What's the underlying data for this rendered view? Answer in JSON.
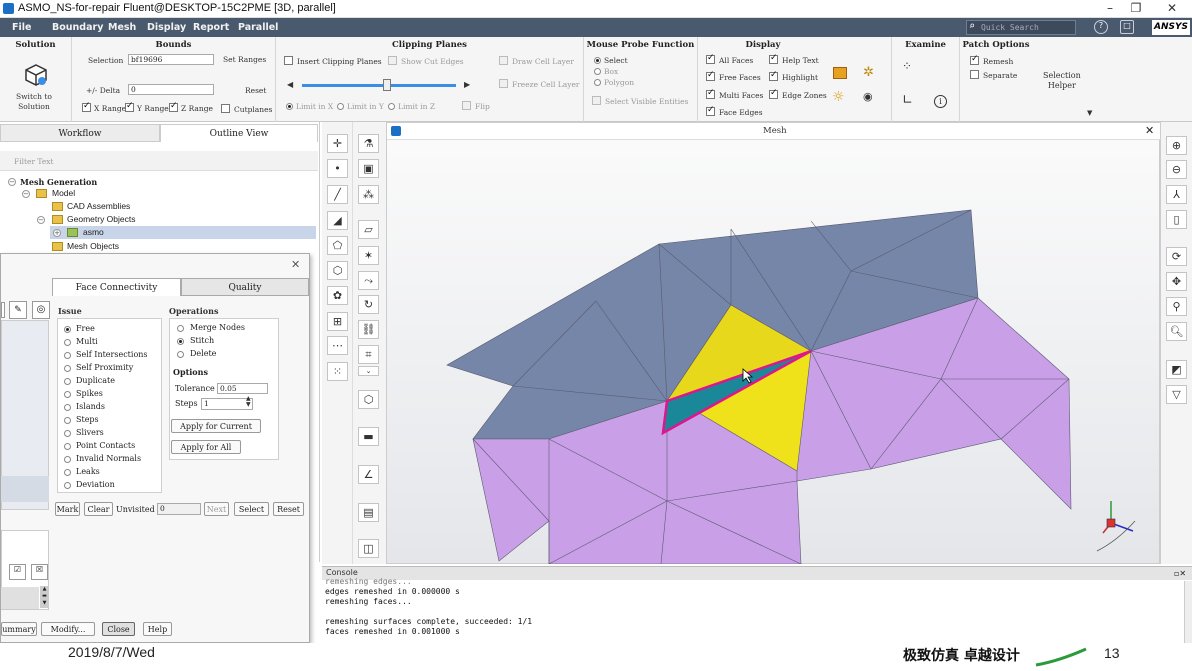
{
  "window": {
    "title": "ASMO_NS-for-repair Fluent@DESKTOP-15C2PME  [3D, parallel]"
  },
  "menu": {
    "items": [
      "File",
      "Boundary",
      "Mesh",
      "Display",
      "Report",
      "Parallel"
    ],
    "search_placeholder": "Quick Search",
    "brand": "ANSYS"
  },
  "ribbon": {
    "solution": {
      "title": "Solution",
      "switch_label": "Switch to\nSolution"
    },
    "bounds": {
      "title": "Bounds",
      "selection_label": "Selection",
      "selection_value": "bf19696",
      "set_ranges": "Set Ranges",
      "delta_label": "+/- Delta",
      "delta_value": "0",
      "reset": "Reset",
      "x_range": "X Range",
      "y_range": "Y Range",
      "z_range": "Z Range",
      "cutplanes": "Cutplanes"
    },
    "clipping": {
      "title": "Clipping Planes",
      "insert": "Insert Clipping Planes",
      "show_cut_edges": "Show Cut Edges",
      "draw_cell_layer": "Draw Cell Layer",
      "freeze_cell_layer": "Freeze Cell Layer",
      "limit_x": "Limit in X",
      "limit_y": "Limit in Y",
      "limit_z": "Limit in Z",
      "flip": "Flip",
      "slider_fraction": 0.55
    },
    "probe": {
      "title": "Mouse Probe Function",
      "select": "Select",
      "box": "Box",
      "polygon": "Polygon",
      "select_visible": "Select Visible Entities"
    },
    "display": {
      "title": "Display",
      "all_faces": "All Faces",
      "help_text": "Help Text",
      "free_faces": "Free Faces",
      "highlight": "Highlight",
      "multi_faces": "Multi Faces",
      "edge_zones": "Edge Zones",
      "face_edges": "Face Edges"
    },
    "examine": {
      "title": "Examine"
    },
    "patch": {
      "title": "Patch Options",
      "remesh": "Remesh",
      "separate": "Separate"
    },
    "selection_helper": "Selection\nHelper"
  },
  "leftpane": {
    "tabs": [
      "Workflow",
      "Outline View"
    ],
    "filter_placeholder": "Filter Text",
    "tree": {
      "root": "Mesh Generation",
      "model": "Model",
      "cad": "CAD Assemblies",
      "geometry": "Geometry Objects",
      "asmo": "asmo",
      "mesh_objects": "Mesh Objects"
    }
  },
  "dialog": {
    "tabs": [
      "Face Connectivity",
      "Quality"
    ],
    "issue_title": "Issue",
    "issues": [
      "Free",
      "Multi",
      "Self Intersections",
      "Self Proximity",
      "Duplicate",
      "Spikes",
      "Islands",
      "Steps",
      "Slivers",
      "Point Contacts",
      "Invalid Normals",
      "Leaks",
      "Deviation"
    ],
    "selected_issue": "Free",
    "operations_title": "Operations",
    "operations": [
      "Merge Nodes",
      "Stitch",
      "Delete"
    ],
    "selected_operation": "Stitch",
    "options_title": "Options",
    "tolerance_label": "Tolerance",
    "tolerance_value": "0.05",
    "steps_label": "Steps",
    "steps_value": "1",
    "apply_current": "Apply for Current",
    "apply_all": "Apply for All",
    "mark": "Mark",
    "clear": "Clear",
    "unvisited_label": "Unvisited",
    "unvisited_value": "0",
    "next": "Next",
    "select": "Select",
    "reset": "Reset",
    "summary": "ummary",
    "modify": "Modify...",
    "close": "Close",
    "help": "Help"
  },
  "viewport": {
    "title": "Mesh"
  },
  "console": {
    "title": "Console",
    "lines": [
      "remeshing edges...",
      "edges remeshed in 0.000000 s",
      "remeshing faces...",
      "",
      "remeshing surfaces complete, succeeded: 1/1",
      "faces remeshed in 0.001000 s"
    ]
  },
  "footer": {
    "date": "2019/8/7/Wed",
    "slogan": "极致仿真 卓越设计",
    "page": "13"
  },
  "colors": {
    "menubar": "#4a5a6e",
    "blue_faces": "#7586a8",
    "purple_faces": "#c9a0e8",
    "yellow_faces": "#e8d81c",
    "teal_face": "#1a8898",
    "highlight_edge": "#e0148c"
  }
}
